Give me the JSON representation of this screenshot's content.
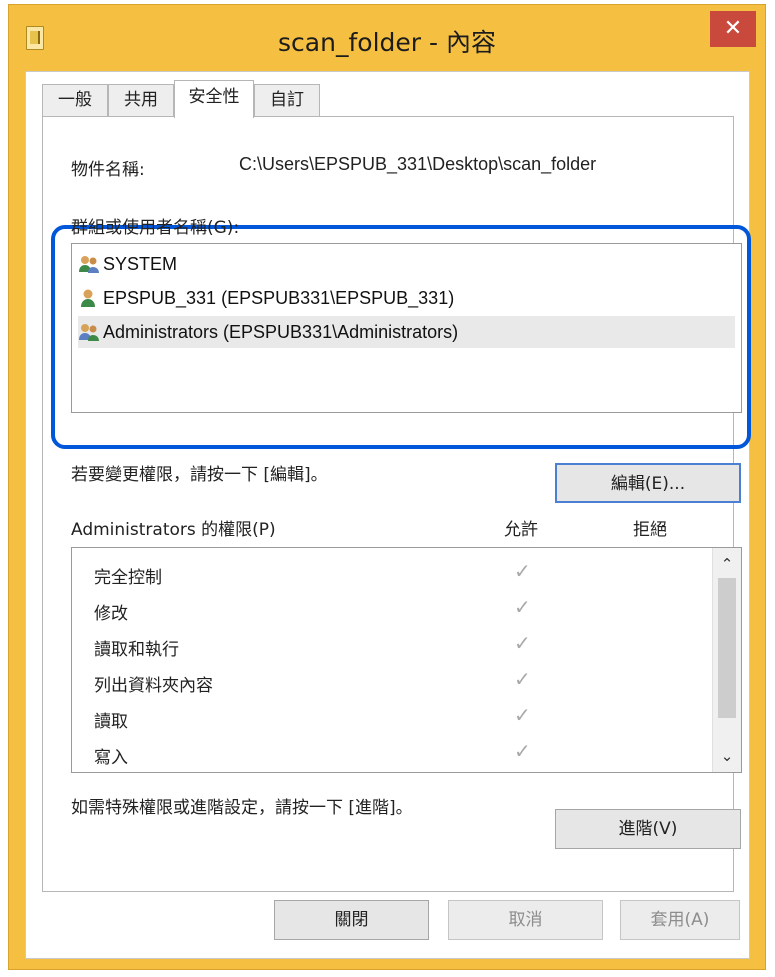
{
  "window": {
    "title": "scan_folder - 內容",
    "close_glyph": "✕"
  },
  "tabs": [
    {
      "label": "一般",
      "active": false
    },
    {
      "label": "共用",
      "active": false
    },
    {
      "label": "安全性",
      "active": true
    },
    {
      "label": "自訂",
      "active": false
    }
  ],
  "security": {
    "object_label": "物件名稱:",
    "object_path": "C:\\Users\\EPSPUB_331\\Desktop\\scan_folder",
    "groups_label": "群組或使用者名稱(G):",
    "groups": [
      {
        "name": "SYSTEM",
        "icon": "group-users-icon",
        "selected": false
      },
      {
        "name": "EPSPUB_331 (EPSPUB331\\EPSPUB_331)",
        "icon": "single-user-icon",
        "selected": false
      },
      {
        "name": "Administrators (EPSPUB331\\Administrators)",
        "icon": "group-users-icon",
        "selected": true
      }
    ],
    "change_hint": "若要變更權限，請按一下 [編輯]。",
    "edit_button": "編輯(E)...",
    "perm_header": "Administrators 的權限(P)",
    "allow_header": "允許",
    "deny_header": "拒絕",
    "permissions": [
      {
        "name": "完全控制",
        "allow": true,
        "deny": false
      },
      {
        "name": "修改",
        "allow": true,
        "deny": false
      },
      {
        "name": "讀取和執行",
        "allow": true,
        "deny": false
      },
      {
        "name": "列出資料夾內容",
        "allow": true,
        "deny": false
      },
      {
        "name": "讀取",
        "allow": true,
        "deny": false
      },
      {
        "name": "寫入",
        "allow": true,
        "deny": false
      }
    ],
    "check_glyph": "✓",
    "advanced_hint": "如需特殊權限或進階設定，請按一下 [進階]。",
    "advanced_button": "進階(V)"
  },
  "footer": {
    "close": "關閉",
    "cancel": "取消",
    "apply": "套用(A)"
  },
  "scrollbar": {
    "up_glyph": "⌃",
    "down_glyph": "⌄"
  },
  "colors": {
    "title_bar": "#f5c041",
    "close_button": "#c94a3d",
    "highlight_border": "#0057d9"
  }
}
